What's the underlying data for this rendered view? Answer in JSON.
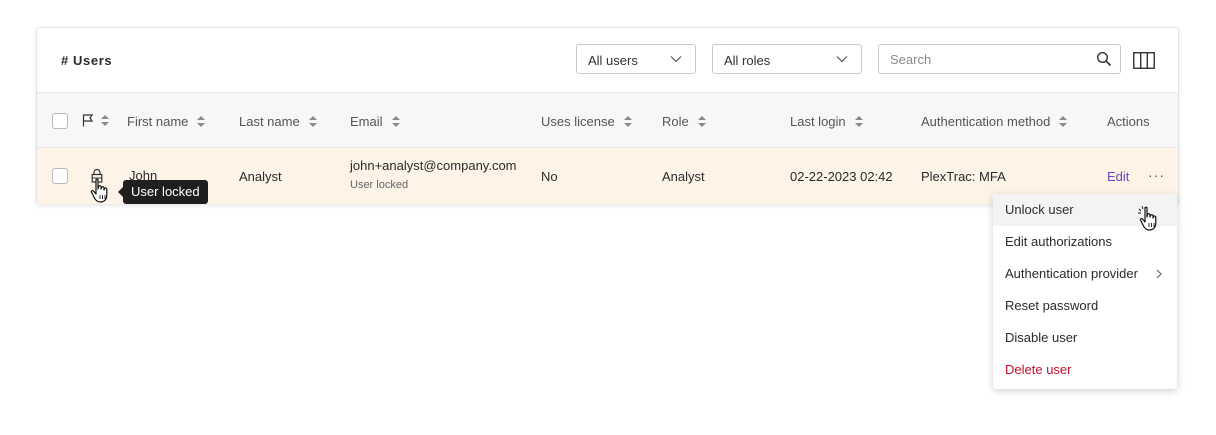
{
  "header": {
    "title": "# Users"
  },
  "filters": {
    "users_select": "All users",
    "roles_select": "All roles",
    "search_placeholder": "Search"
  },
  "icons": {
    "columns": "columns-icon",
    "search": "search-icon",
    "flag": "flag-icon",
    "lock": "lock-icon",
    "chevron": "chevron-down-icon",
    "pointer": "pointer-hand-icon"
  },
  "table": {
    "columns": [
      "First name",
      "Last name",
      "Email",
      "Uses license",
      "Role",
      "Last login",
      "Authentication method",
      "Actions"
    ],
    "row": {
      "first_name": "John",
      "last_name": "Analyst",
      "email": "john+analyst@company.com",
      "email_sub": "User locked",
      "uses_license": "No",
      "role": "Analyst",
      "last_login": "02-22-2023 02:42",
      "auth_method": "PlexTrac: MFA",
      "edit": "Edit",
      "more": "···"
    }
  },
  "tooltip": {
    "text": "User locked"
  },
  "menu": {
    "items": [
      "Unlock user",
      "Edit authorizations",
      "Authentication provider",
      "Reset password",
      "Disable user",
      "Delete user"
    ]
  },
  "colors": {
    "accent": "#6b46c1",
    "danger": "#c4122f",
    "row_highlight": "#fdf3e7"
  }
}
